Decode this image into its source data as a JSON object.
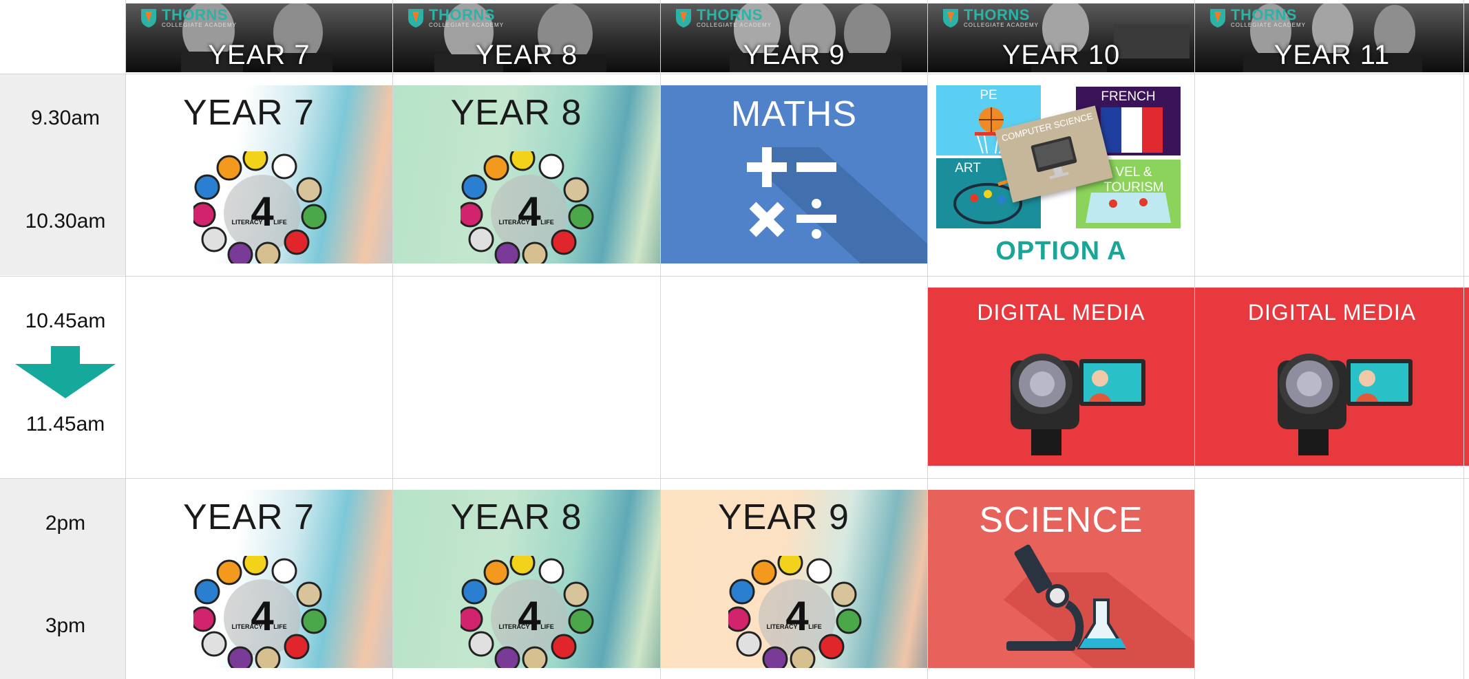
{
  "headers": [
    {
      "label": "YEAR 7",
      "logo": "THORNS",
      "logo_sub": "COLLEGIATE ACADEMY"
    },
    {
      "label": "YEAR 8",
      "logo": "THORNS",
      "logo_sub": "COLLEGIATE ACADEMY"
    },
    {
      "label": "YEAR 9",
      "logo": "THORNS",
      "logo_sub": "COLLEGIATE ACADEMY"
    },
    {
      "label": "YEAR 10",
      "logo": "THORNS",
      "logo_sub": "COLLEGIATE ACADEMY"
    },
    {
      "label": "YEAR 11",
      "logo": "THORNS",
      "logo_sub": "COLLEGIATE ACADEMY"
    }
  ],
  "times": {
    "slot1_start": "9.30am",
    "slot1_end": "10.30am",
    "slot2_start": "10.45am",
    "slot2_end": "11.45am",
    "slot3_start": "2pm",
    "slot3_end": "3pm"
  },
  "tiles": {
    "s1_y7": "YEAR 7",
    "s1_y8": "YEAR 8",
    "s1_y9": "MATHS",
    "s2_y10": "DIGITAL MEDIA",
    "s2_y11": "DIGITAL MEDIA",
    "s3_y7": "YEAR 7",
    "s3_y8": "YEAR 8",
    "s3_y9": "YEAR 9",
    "s3_y10": "SCIENCE"
  },
  "literacy_logo": {
    "left": "LITERACY",
    "right": "LIFE",
    "number": "4"
  },
  "option_a": {
    "pe": "PE",
    "french": "FRENCH",
    "art": "ART",
    "travel": "VEL & TOURISM",
    "computer_science": "COMPUTER SCIENCE",
    "caption": "OPTION A"
  },
  "colors": {
    "teal": "#14a99b",
    "digital_media_red": "#e8393f",
    "science_salmon": "#e7625b",
    "maths_blue": "#4f82c8",
    "time_column_gray": "#eeeeee"
  }
}
